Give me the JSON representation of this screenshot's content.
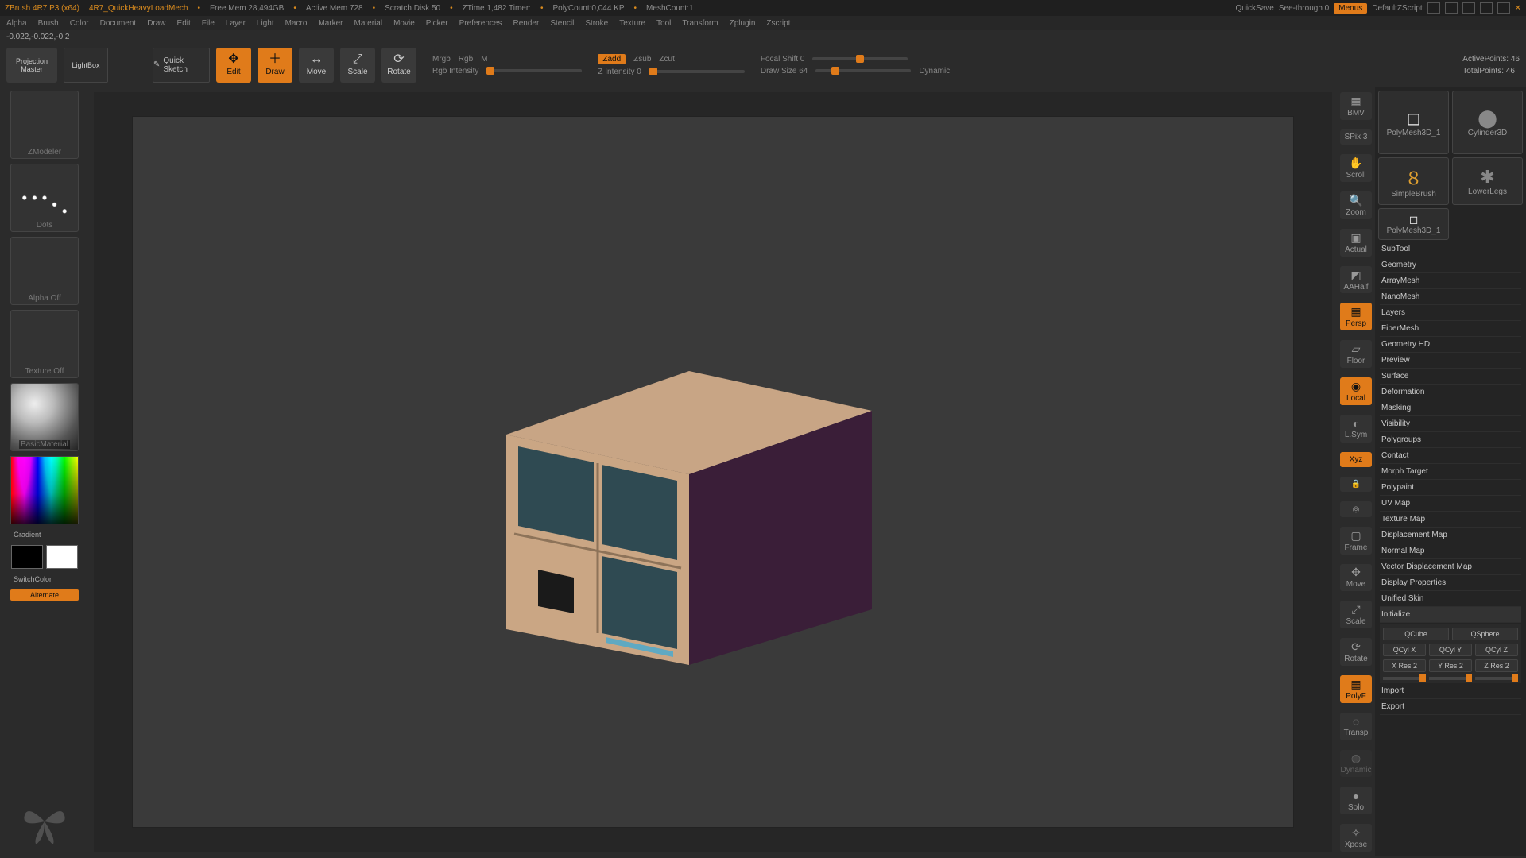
{
  "titlebar": {
    "app": "ZBrush 4R7 P3 (x64)",
    "doc": "4R7_QuickHeavyLoadMech",
    "free_mem": "Free Mem 28,494GB",
    "active_mem": "Active Mem 728",
    "scratch": "Scratch Disk 50",
    "ztime": "ZTime 1,482 Timer:",
    "polycount": "PolyCount:0,044 KP",
    "meshcount": "MeshCount:1",
    "quicksave": "QuickSave",
    "seethrough": "See-through  0",
    "menus": "Menus",
    "defzscript": "DefaultZScript"
  },
  "menu": [
    "Alpha",
    "Brush",
    "Color",
    "Document",
    "Draw",
    "Edit",
    "File",
    "Layer",
    "Light",
    "Macro",
    "Marker",
    "Material",
    "Movie",
    "Picker",
    "Preferences",
    "Render",
    "Stencil",
    "Stroke",
    "Texture",
    "Tool",
    "Transform",
    "Zplugin",
    "Zscript"
  ],
  "coord": "-0.022,-0.022,-0.2",
  "toolbar": {
    "projection": "Projection Master",
    "lightbox": "LightBox",
    "quicksketch": "Quick Sketch",
    "edit": "Edit",
    "draw": "Draw",
    "move": "Move",
    "scale": "Scale",
    "rotate": "Rotate",
    "mrgb": "Mrgb",
    "rgb": "Rgb",
    "m": "M",
    "rgb_intensity": "Rgb Intensity",
    "zadd": "Zadd",
    "zsub": "Zsub",
    "zcut": "Zcut",
    "z_intensity": "Z Intensity 0",
    "focal": "Focal Shift 0",
    "draw_size": "Draw Size 64",
    "dynamic": "Dynamic",
    "active_points": "ActivePoints: 46",
    "total_points": "TotalPoints: 46"
  },
  "leftcol": {
    "zmodeler": "ZModeler",
    "dots": "Dots",
    "alpha": "Alpha Off",
    "texture": "Texture Off",
    "material": "BasicMaterial",
    "gradient": "Gradient",
    "switch": "SwitchColor",
    "alternate": "Alternate"
  },
  "rightcol": {
    "bmv": "BMV",
    "spix": "SPix 3",
    "scroll": "Scroll",
    "zoom": "Zoom",
    "actual": "Actual",
    "aahalf": "AAHalf",
    "persp": "Persp",
    "floor": "Floor",
    "local": "Local",
    "lsym": "L.Sym",
    "xyz": "Xyz",
    "frame": "Frame",
    "move": "Move",
    "scale": "Scale",
    "rotate": "Rotate",
    "polyf": "PolyF",
    "transp": "Transp",
    "dynamic": "Dynamic",
    "solo": "Solo",
    "xpose": "Xpose"
  },
  "toolshelf": {
    "polymesh": "PolyMesh3D_1",
    "cylinder": "Cylinder3D",
    "simplebrush": "SimpleBrush",
    "lowerlegs": "LowerLegs",
    "polymesh2": "PolyMesh3D_1"
  },
  "panels": [
    "SubTool",
    "Geometry",
    "ArrayMesh",
    "NanoMesh",
    "Layers",
    "FiberMesh",
    "Geometry HD",
    "Preview",
    "Surface",
    "Deformation",
    "Masking",
    "Visibility",
    "Polygroups",
    "Contact",
    "Morph Target",
    "Polypaint",
    "UV Map",
    "Texture Map",
    "Displacement Map",
    "Normal Map",
    "Vector Displacement Map",
    "Display Properties",
    "Unified Skin",
    "Initialize"
  ],
  "init": {
    "qcube": "QCube",
    "qsphere": "QSphere",
    "qcylx": "QCyl X",
    "qcyly": "QCyl Y",
    "qcylz": "QCyl Z",
    "xres": "X Res 2",
    "yres": "Y Res 2",
    "zres": "Z Res 2"
  },
  "io": {
    "import": "Import",
    "export": "Export"
  }
}
